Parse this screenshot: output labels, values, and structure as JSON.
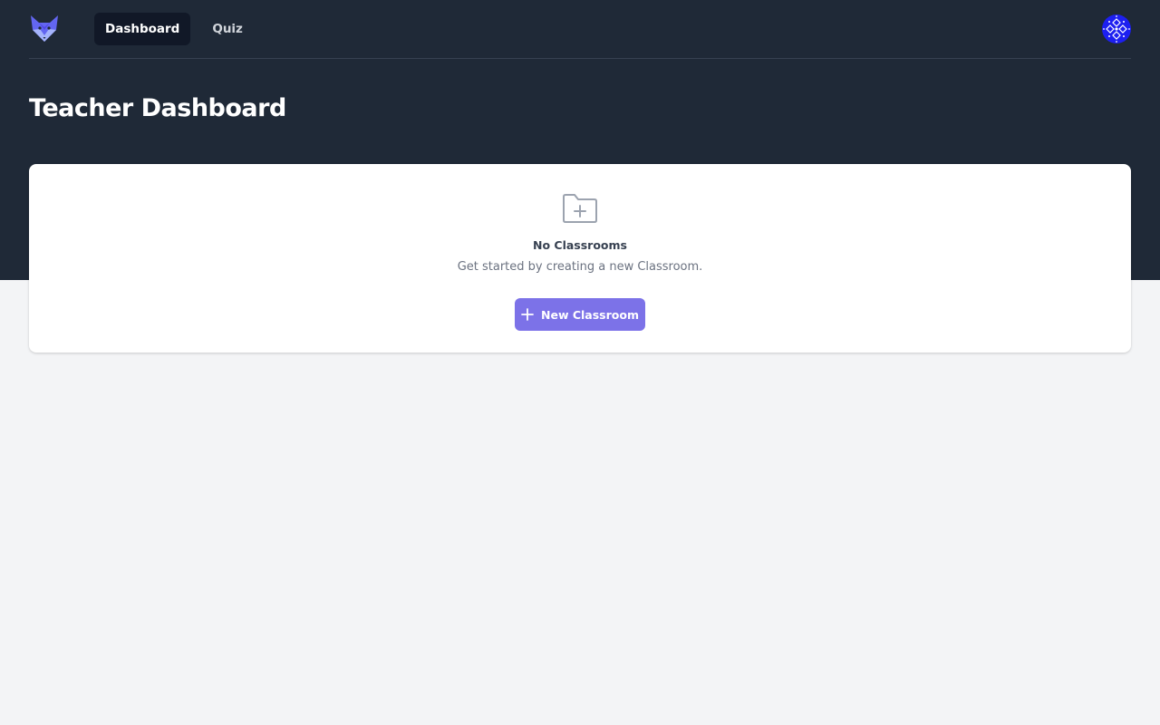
{
  "nav": {
    "logo_icon": "fox-logo-icon",
    "tabs": [
      {
        "label": "Dashboard",
        "active": true
      },
      {
        "label": "Quiz",
        "active": false
      }
    ],
    "avatar_icon": "avatar-pattern-icon"
  },
  "page": {
    "title": "Teacher Dashboard"
  },
  "empty_state": {
    "icon": "folder-plus-icon",
    "title": "No Classrooms",
    "subtitle": "Get started by creating a new Classroom.",
    "button_label": "New Classroom",
    "button_icon": "plus-icon"
  },
  "colors": {
    "header_bg": "#1f2937",
    "page_bg": "#f3f4f6",
    "accent": "#7c72e8",
    "avatar": "#1d1ff0"
  }
}
